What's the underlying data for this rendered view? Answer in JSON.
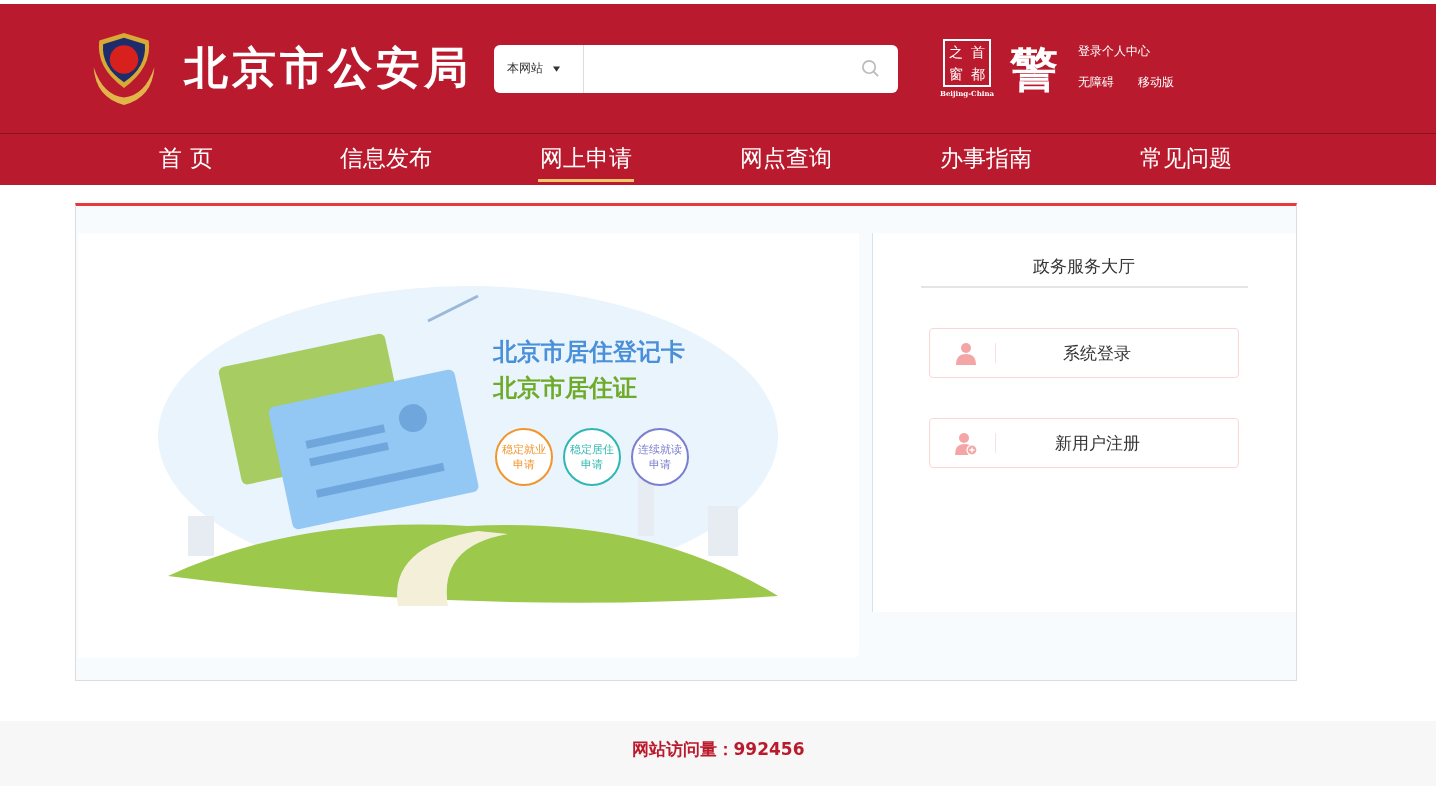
{
  "header": {
    "site_title": "北京市公安局",
    "search": {
      "scope": "本网站"
    },
    "capital_logo": {
      "characters": [
        "之",
        "首",
        "窗",
        "都"
      ],
      "caption": "Beijing-China"
    },
    "police_logo": {
      "character": "警"
    },
    "links": [
      "登录个人中心",
      "无障碍",
      "移动版"
    ]
  },
  "nav": [
    {
      "label": "首 页",
      "selected": false
    },
    {
      "label": "信息发布",
      "selected": false
    },
    {
      "label": "网上申请",
      "selected": true
    },
    {
      "label": "网点查询",
      "selected": false
    },
    {
      "label": "办事指南",
      "selected": false
    },
    {
      "label": "常见问题",
      "selected": false
    }
  ],
  "banner": {
    "titles": [
      "北京市居住登记卡",
      "北京市居住证"
    ],
    "badges": [
      {
        "line1": "稳定就业",
        "line2": "申请",
        "color": "#f0962e"
      },
      {
        "line1": "稳定居住",
        "line2": "申请",
        "color": "#2fb8b3"
      },
      {
        "line1": "连续就读",
        "line2": "申请",
        "color": "#7b7fcf"
      }
    ]
  },
  "service_hall": {
    "title": "政务服务大厅",
    "actions": [
      {
        "kind": "login",
        "label": "系统登录"
      },
      {
        "kind": "register",
        "label": "新用户注册"
      }
    ]
  },
  "footer": {
    "visits": "网站访问量：992456"
  }
}
